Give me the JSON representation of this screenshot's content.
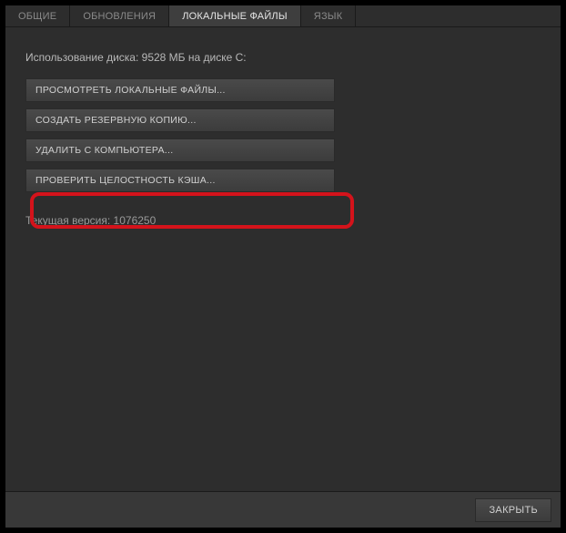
{
  "tabs": [
    {
      "label": "ОБЩИЕ",
      "active": false
    },
    {
      "label": "ОБНОВЛЕНИЯ",
      "active": false
    },
    {
      "label": "ЛОКАЛЬНЫЕ ФАЙЛЫ",
      "active": true
    },
    {
      "label": "ЯЗЫК",
      "active": false
    }
  ],
  "content": {
    "disk_usage": "Использование диска: 9528 МБ на диске C:",
    "buttons": {
      "browse": "ПРОСМОТРЕТЬ ЛОКАЛЬНЫЕ ФАЙЛЫ...",
      "backup": "СОЗДАТЬ РЕЗЕРВНУЮ КОПИЮ...",
      "delete": "УДАЛИТЬ С КОМПЬЮТЕРА...",
      "verify": "ПРОВЕРИТЬ ЦЕЛОСТНОСТЬ КЭША..."
    },
    "version": "Текущая версия: 1076250"
  },
  "footer": {
    "close": "ЗАКРЫТЬ"
  }
}
